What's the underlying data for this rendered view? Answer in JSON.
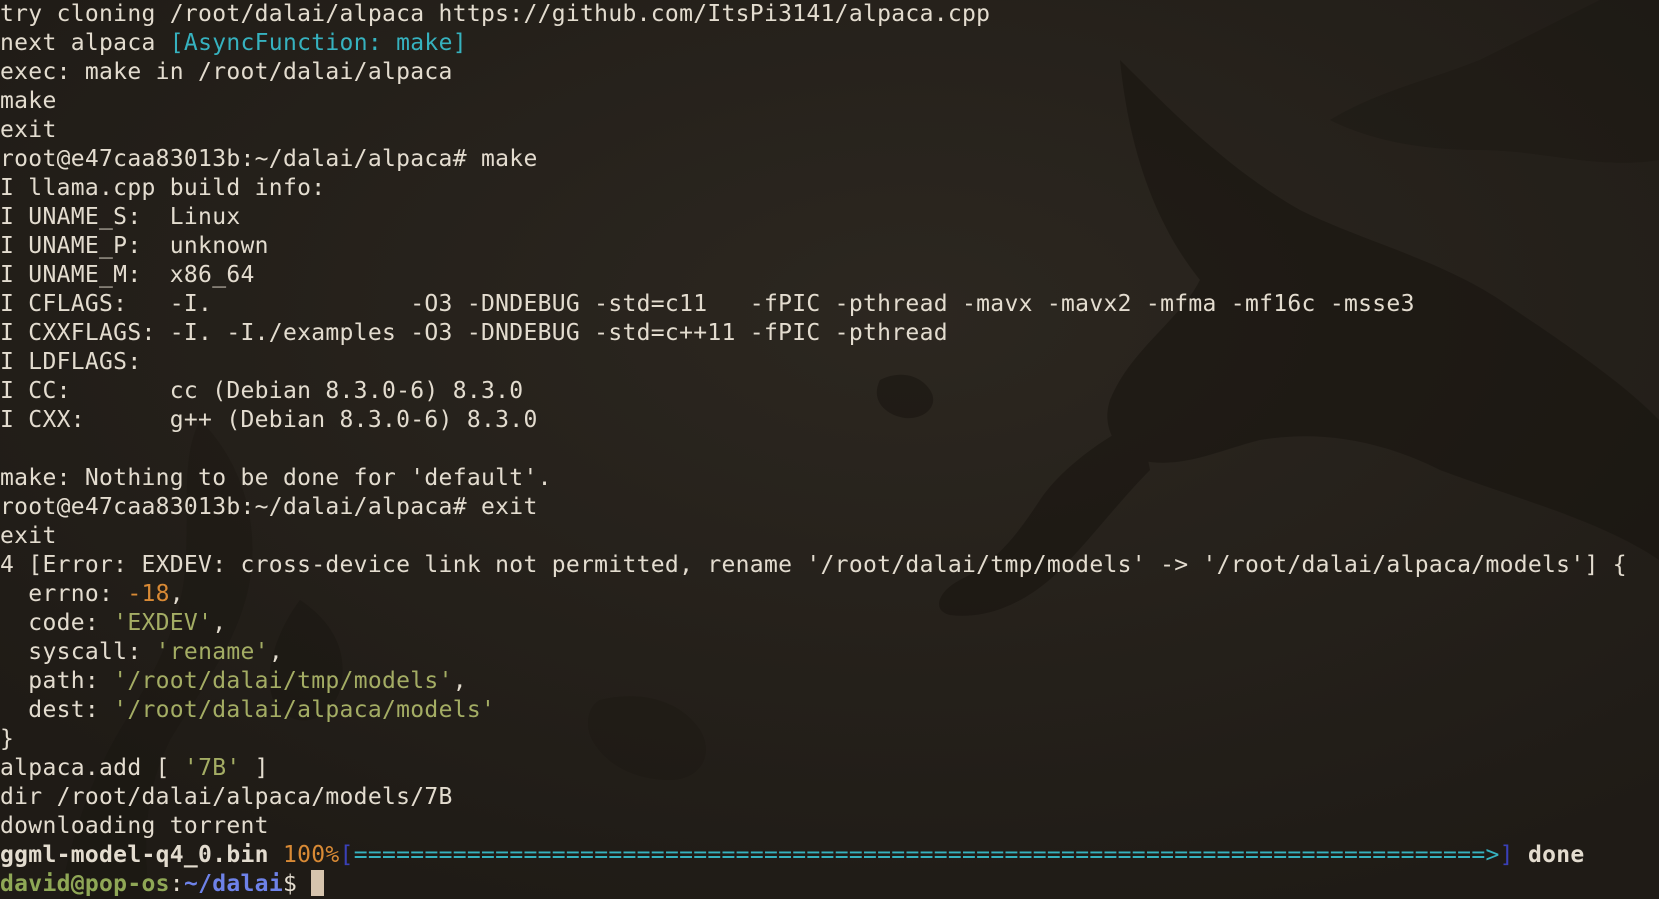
{
  "colors": {
    "background": "#231f1a",
    "foreground": "#e3dccf",
    "cyan": "#36b2bf",
    "orange": "#d98a35",
    "green": "#a4ad64",
    "prompt_user": "#8fa756",
    "prompt_path": "#6e82e8"
  },
  "terminal": {
    "l01": "try cloning /root/dalai/alpaca https://github.com/ItsPi3141/alpaca.cpp",
    "l02a": "next alpaca ",
    "l02b": "[AsyncFunction: make]",
    "l03": "exec: make in /root/dalai/alpaca",
    "l04": "make",
    "l05": "exit",
    "l06": "root@e47caa83013b:~/dalai/alpaca# make",
    "l07": "I llama.cpp build info:",
    "l08": "I UNAME_S:  Linux",
    "l09": "I UNAME_P:  unknown",
    "l10": "I UNAME_M:  x86_64",
    "l11": "I CFLAGS:   -I.              -O3 -DNDEBUG -std=c11   -fPIC -pthread -mavx -mavx2 -mfma -mf16c -msse3",
    "l12": "I CXXFLAGS: -I. -I./examples -O3 -DNDEBUG -std=c++11 -fPIC -pthread",
    "l13": "I LDFLAGS:",
    "l14": "I CC:       cc (Debian 8.3.0-6) 8.3.0",
    "l15": "I CXX:      g++ (Debian 8.3.0-6) 8.3.0",
    "l17": "make: Nothing to be done for 'default'.",
    "l18": "root@e47caa83013b:~/dalai/alpaca# exit",
    "l19": "exit",
    "l20": "4 [Error: EXDEV: cross-device link not permitted, rename '/root/dalai/tmp/models' -> '/root/dalai/alpaca/models'] {",
    "l21a": "  errno: ",
    "l21b": "-18",
    "l21c": ",",
    "l22a": "  code: ",
    "l22b": "'EXDEV'",
    "l22c": ",",
    "l23a": "  syscall: ",
    "l23b": "'rename'",
    "l23c": ",",
    "l24a": "  path: ",
    "l24b": "'/root/dalai/tmp/models'",
    "l24c": ",",
    "l25a": "  dest: ",
    "l25b": "'/root/dalai/alpaca/models'",
    "l26": "}",
    "l27a": "alpaca.add [ ",
    "l27b": "'7B'",
    "l27c": " ]",
    "l28": "dir /root/dalai/alpaca/models/7B",
    "l29": "downloading torrent"
  },
  "progress": {
    "filename": "ggml-model-q4_0.bin",
    "percent_text": "100%",
    "open_bracket": "[",
    "bar": "================================================================================>",
    "close_bracket": "]",
    "status": "done",
    "fraction": 1.0
  },
  "prompt": {
    "user_host": "david@pop-os",
    "colon": ":",
    "path": "~/dalai",
    "symbol": "$ "
  }
}
